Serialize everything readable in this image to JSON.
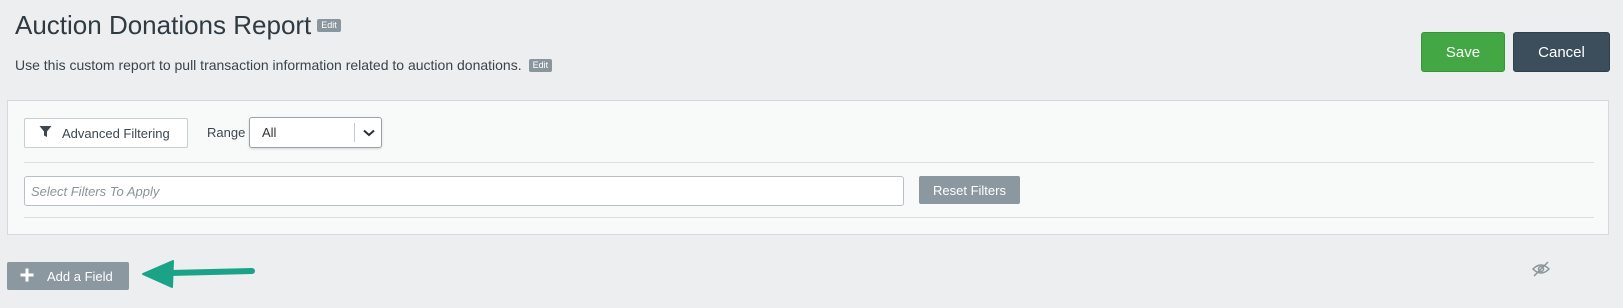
{
  "header": {
    "title": "Auction Donations Report",
    "title_edit": "Edit",
    "description": "Use this custom report to pull transaction information related to auction donations.",
    "description_edit": "Edit"
  },
  "actions": {
    "save_label": "Save",
    "cancel_label": "Cancel"
  },
  "filters": {
    "advanced_label": "Advanced Filtering",
    "range_label": "Range",
    "range_value": "All",
    "input_placeholder": "Select Filters To Apply",
    "reset_label": "Reset Filters"
  },
  "footer": {
    "add_field_label": "Add a Field"
  },
  "icons": {
    "filter": "funnel-icon",
    "dropdown": "chevron-down-icon",
    "add": "plus-icon",
    "visibility": "eye-slash-icon",
    "annotation": "arrow-left-annotation"
  },
  "colors": {
    "save": "#43a843",
    "cancel": "#3c4e5b",
    "muted_button": "#8b989f",
    "annotation_arrow": "#1aa386"
  }
}
